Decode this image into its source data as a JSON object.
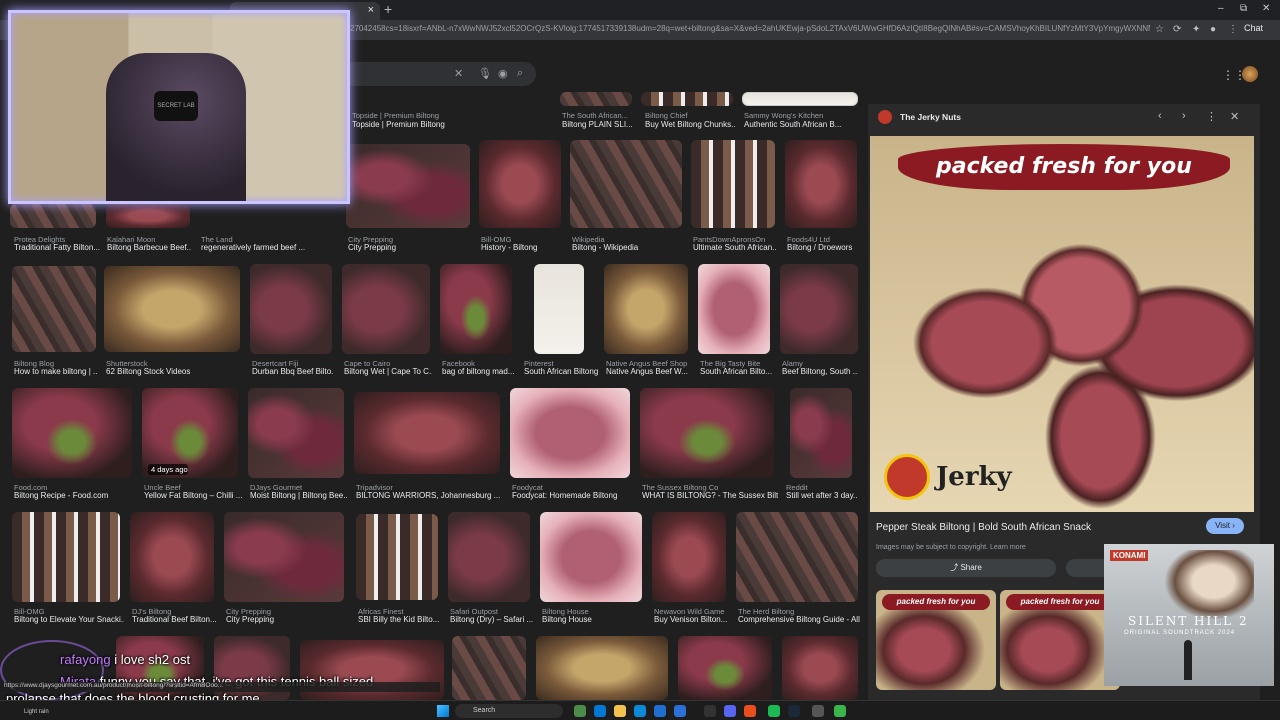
{
  "browser": {
    "close_tab": "×",
    "new_tab": "+",
    "url": "27042458cs=18isxrf=ANbL-n7xWwNWJ52xcl52OCrQzS-KVlolg:1774517339138udm=28q=wet+biltong&sa=X&ved=2ahUKEwja-pSdoL2TAxV6UWwGHfD6AzIQtI8BegQINhAB#sv=CAMSVhoyKhBILUNfYzMtY3VpYmgyWXNNMg5DX2MzLWN1aWMilzT...",
    "chat_label": "Chat",
    "window_controls": [
      "–",
      "⧉",
      "✕"
    ]
  },
  "search": {
    "clear": "✕"
  },
  "grid": {
    "row0": [
      {
        "source": "Topside | Premium Biltong",
        "title": "Topside | Premium Biltong"
      },
      {
        "source": "The South African...",
        "title": "Biltong PLAIN SLI..."
      },
      {
        "source": "Biltong Chief",
        "title": "Buy Wet Biltong Chunks..."
      },
      {
        "source": "Sammy Wong's Kitchen",
        "title": "Authentic South African B..."
      }
    ],
    "row1": [
      {
        "source": "Protea Delights",
        "title": "Traditional Fatty Bilton..."
      },
      {
        "source": "Kalahari Moon",
        "title": "Biltong Barbecue Beef..."
      },
      {
        "source": "The Land",
        "title": "regeneratively farmed beef ..."
      },
      {
        "source": "City Prepping",
        "title": "City Prepping"
      },
      {
        "source": "Bill-OMG",
        "title": "History - Biltong"
      },
      {
        "source": "Wikipedia",
        "title": "Biltong - Wikipedia"
      },
      {
        "source": "PantsDownApronsOn",
        "title": "Ultimate South African..."
      },
      {
        "source": "Foods4U Ltd",
        "title": "Biltong / Droewors"
      }
    ],
    "row2": [
      {
        "source": "Biltong Blog",
        "title": "How to make biltong | ..."
      },
      {
        "source": "Shutterstock",
        "title": "62 Biltong Stock Videos"
      },
      {
        "source": "Desertcart Fiji",
        "title": "Durban Bbq Beef Bilto..."
      },
      {
        "source": "Cape to Cairo",
        "title": "Biltong Wet | Cape To C..."
      },
      {
        "source": "Facebook",
        "title": "bag of biltong mad..."
      },
      {
        "source": "Pinterest",
        "title": "South African Biltong"
      },
      {
        "source": "Native Angus Beef Shop",
        "title": "Native Angus Beef W..."
      },
      {
        "source": "The Big Tasty Bite",
        "title": "South African Bilto..."
      },
      {
        "source": "Alamy",
        "title": "Beef Biltong, South ..."
      }
    ],
    "row3": [
      {
        "source": "Food.com",
        "title": "Biltong Recipe - Food.com"
      },
      {
        "source": "Uncle Beef",
        "title": "Yellow Fat Biltong – Chilli ..."
      },
      {
        "source": "DJays Gourmet",
        "title": "Moist Biltong | Biltong Bee..."
      },
      {
        "source": "Tripadvisor",
        "title": "BILTONG WARRIORS, Johannesburg ..."
      },
      {
        "source": "Foodycat",
        "title": "Foodycat: Homemade Biltong"
      },
      {
        "source": "The Sussex Biltong Co",
        "title": "WHAT IS BILTONG? - The Sussex Bilt..."
      },
      {
        "source": "Reddit",
        "title": "Still wet after 3 day..."
      }
    ],
    "row4": [
      {
        "source": "Bill-OMG",
        "title": "Biltong to Elevate Your Snacki..."
      },
      {
        "source": "DJ's Biltong",
        "title": "Traditional Beef Bilton..."
      },
      {
        "source": "City Prepping",
        "title": "City Prepping"
      },
      {
        "source": "Africas Finest",
        "title": "SBI Billy the Kid Bilto..."
      },
      {
        "source": "Safari Outpost",
        "title": "Biltong (Dry) – Safari ..."
      },
      {
        "source": "Biltong House",
        "title": "Biltong House"
      },
      {
        "source": "Newavon Wild Game",
        "title": "Buy Venison Bilton..."
      },
      {
        "source": "The Herd Biltong",
        "title": "Comprehensive Biltong Guide - All..."
      }
    ],
    "badge_days_ago": "4 days ago"
  },
  "preview": {
    "source": "The Jerky Nuts",
    "banner": "packed fresh for you",
    "logo_text": "Jerky",
    "title": "Pepper Steak Biltong | Bold South African Snack",
    "visit": "Visit ›",
    "copyright": "Images may be subject to copyright. Learn more",
    "share": "Share",
    "related_banner": "packed fresh for you"
  },
  "webcam": {
    "chair_brand": "SECRET LAB"
  },
  "album": {
    "brand": "KONAMI",
    "title": "SILENT HILL 2",
    "subtitle": "ORIGINAL SOUNDTRACK 2024"
  },
  "chat": {
    "user1": "rafayong",
    "msg1": "i love sh2 ost",
    "user2": "Mirata",
    "msg2": "funny you say that, i've got this tennis ball sized",
    "msg3": "prolapse that does the blood crusting for me"
  },
  "status_url": "https://www.djaysgourmet.com.au/product/moist-biltong/?srsltid=AfmBOoo...",
  "taskbar": {
    "weather": "Light rain",
    "search": "Search"
  }
}
